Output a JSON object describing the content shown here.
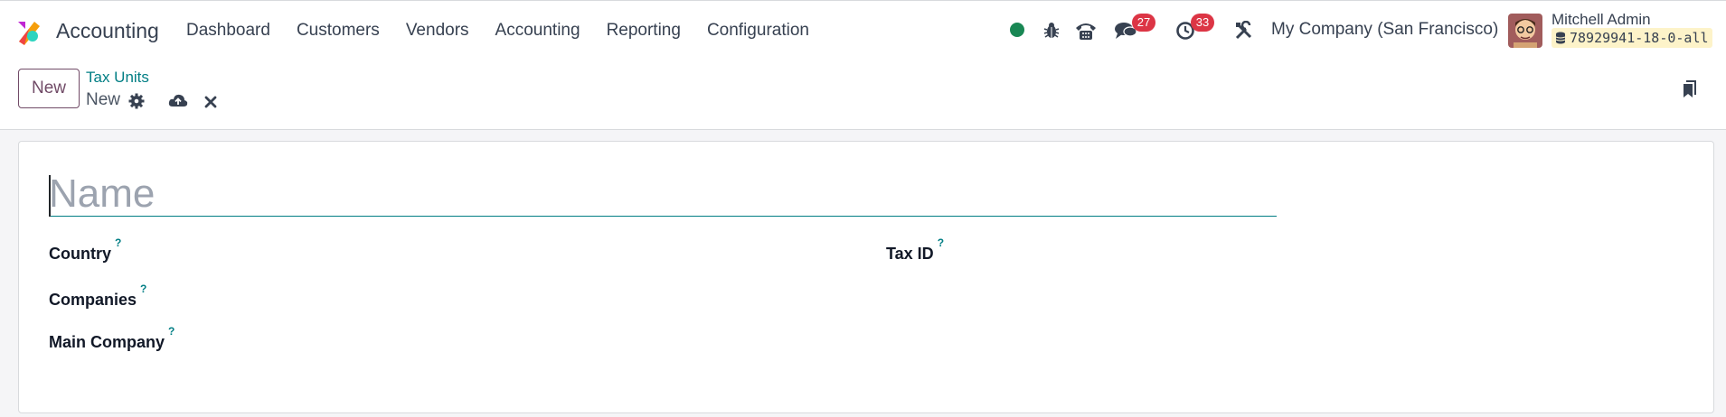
{
  "navbar": {
    "app_name": "Accounting",
    "menu": [
      {
        "label": "Dashboard"
      },
      {
        "label": "Customers"
      },
      {
        "label": "Vendors"
      },
      {
        "label": "Accounting"
      },
      {
        "label": "Reporting"
      },
      {
        "label": "Configuration"
      }
    ],
    "systray": {
      "status_color": "#198754",
      "messages_count": "27",
      "activities_count": "33",
      "company": "My Company (San Francisco)",
      "user_name": "Mitchell Admin",
      "database": "78929941-18-0-all"
    },
    "brand_color": "#714b67",
    "accent_color": "#017e84"
  },
  "control_panel": {
    "new_button": "New",
    "breadcrumb_parent": "Tax Units",
    "breadcrumb_current": "New"
  },
  "form": {
    "name_placeholder": "Name",
    "fields": {
      "country": "Country",
      "tax_id": "Tax ID",
      "companies": "Companies",
      "main_company": "Main Company"
    },
    "help_mark": "?"
  }
}
